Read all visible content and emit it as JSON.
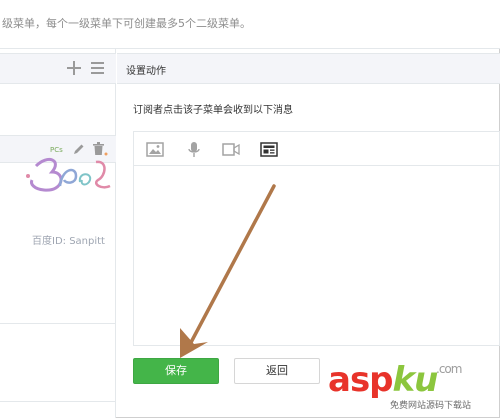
{
  "top_hint": "级菜单，每个一级菜单下可创建最多5个二级菜单。",
  "right_panel": {
    "title": "设置动作",
    "description": "订阅者点击该子菜单会收到以下消息"
  },
  "editor": {
    "tools": [
      "image-icon",
      "microphone-icon",
      "video-icon",
      "news-icon"
    ],
    "active_tool": "news-icon"
  },
  "buttons": {
    "save": "保存",
    "back": "返回"
  },
  "watermark": {
    "text": "百度ID: Sanpitt"
  },
  "logo": {
    "asp": "asp",
    "ku": "ku",
    "tld": ".com",
    "subtitle": "免费网站源码下载站"
  },
  "colors": {
    "primary_green": "#44b549",
    "arrow": "#b0784a",
    "logo_red": "#e8332a",
    "logo_green": "#8cc63e"
  }
}
